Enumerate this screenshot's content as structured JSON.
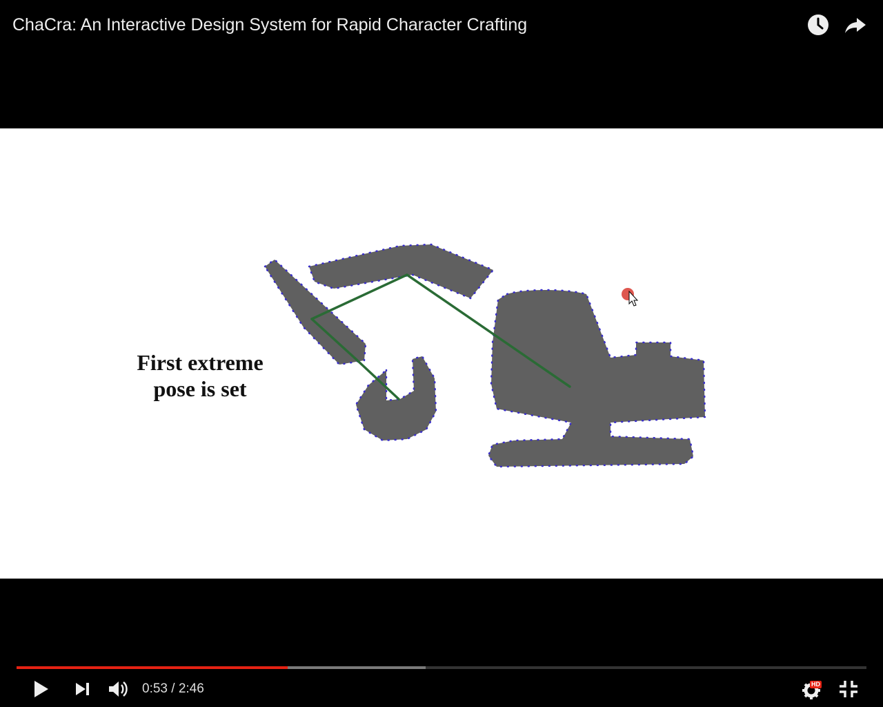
{
  "window": {
    "title": "ChaCra: An Interactive Design System for Rapid Character Crafting"
  },
  "video": {
    "caption_line1": "First extreme",
    "caption_line2": "pose is set"
  },
  "player": {
    "current_time": "0:53",
    "separator": "/",
    "duration": "2:46",
    "played_fraction": 0.319,
    "buffered_fraction": 0.481,
    "hd_label": "HD"
  },
  "colors": {
    "progress_played": "#e52213",
    "progress_buffered": "#7a7a7a",
    "shape_fill": "#606060",
    "skeleton_line": "#2a6b35",
    "vertex_dot": "#3a2fc8"
  },
  "icons": {
    "watch_later": "clock-icon",
    "share": "share-arrow-icon",
    "play": "play-icon",
    "next": "skip-next-icon",
    "volume": "volume-icon",
    "settings": "gear-icon",
    "exit_fullscreen": "exit-fullscreen-icon"
  }
}
